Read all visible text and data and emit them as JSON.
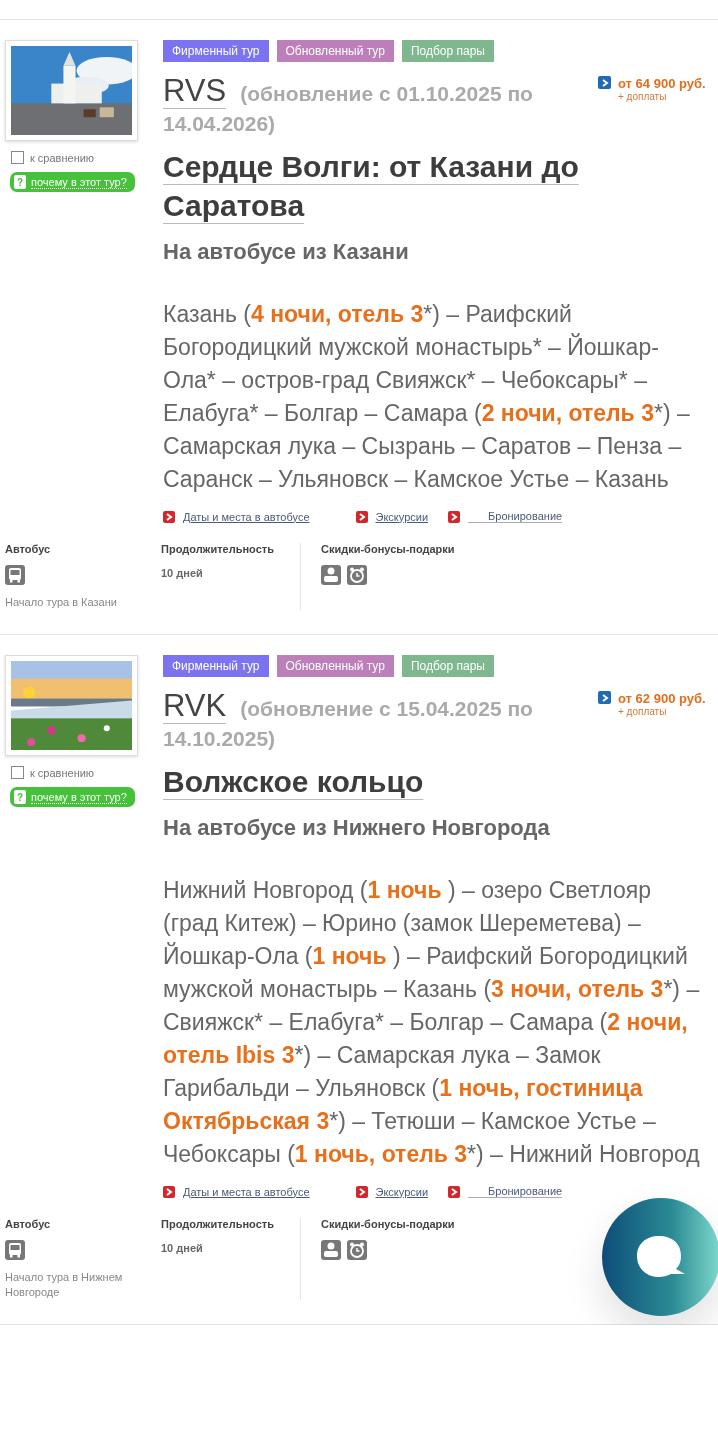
{
  "tours": [
    {
      "tags": [
        {
          "label": "Фирменный тур",
          "color": "#7b73f0"
        },
        {
          "label": "Обновленный тур",
          "color": "#bd7fb9"
        },
        {
          "label": "Подбор пары",
          "color": "#7fb88e"
        }
      ],
      "compare": {
        "label": "к сравнению",
        "checked": false
      },
      "why": "почему в этот тур?",
      "help_mark": "?",
      "code": "RVS",
      "update": "(обновление с 01.10.2025 по 14.04.2026)",
      "title": "Сердце Волги: от Казани до Саратова",
      "subtitle": "На автобусе из Казани",
      "route": "Казань (**4 ночи, отель 3***) – Раифский Богородицкий мужской монастырь* – Йошкар-Ола* – остров-град Свияжск* – Чебоксары* – Елабуга* – Болгар – Самара (**2 ночи, отель 3***) – Самарская лука – Сызрань – Саратов – Пенза – Саранск – Ульяновск – Камское Устье – Казань",
      "price": "от 64 900 руб.",
      "extra": "+ доплаты",
      "links": [
        "Даты и места в автобусе",
        "Экскурсии",
        "Бронирование"
      ],
      "transport": "Автобус",
      "start": "Начало тура в Казани",
      "duration_label": "Продолжительность",
      "duration": "10 дней",
      "bonus_label": "Скидки-бонусы-подарки"
    },
    {
      "tags": [
        {
          "label": "Фирменный тур",
          "color": "#7b73f0"
        },
        {
          "label": "Обновленный тур",
          "color": "#bd7fb9"
        },
        {
          "label": "Подбор пары",
          "color": "#7fb88e"
        }
      ],
      "compare": {
        "label": "к сравнению",
        "checked": false
      },
      "why": "почему в этот тур?",
      "help_mark": "?",
      "code": "RVK",
      "update": "(обновление с 15.04.2025 по 14.10.2025)",
      "title": "Волжское кольцо",
      "subtitle": "На автобусе из Нижнего Новгорода",
      "route": "Нижний Новгород (**1 ночь** ) – озеро Светлояр (град Китеж) – Юрино (замок Шереметева) – Йошкар-Ола (**1 ночь** ) – Раифский Богородицкий мужской монастырь – Казань (**3 ночи, отель 3***) – Свияжск* – Елабуга* – Болгар – Самара (**2 ночи, отель Ibis 3***) – Самарская лука – Замок Гарибальди – Ульяновск (**1 ночь,** **гостиница Октябрьская 3***) – Тетюши – Камское Устье – Чебоксары (**1 ночь, отель** **3***) – Нижний Новгород",
      "price": "от 62 900 руб.",
      "extra": "+ доплаты",
      "links": [
        "Даты и места в автобусе",
        "Экскурсии",
        "Бронирование"
      ],
      "transport": "Автобус",
      "start": "Начало тура в Нижнем Новгороде",
      "duration_label": "Продолжительность",
      "duration": "10 дней",
      "bonus_label": "Скидки-бонусы-подарки"
    }
  ]
}
